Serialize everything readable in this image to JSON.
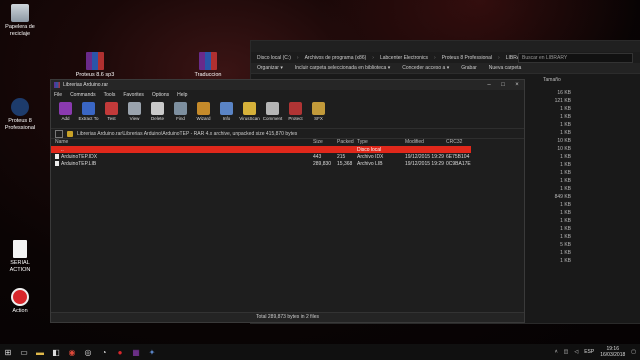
{
  "desktop": {
    "icons": [
      {
        "label": "Papelera de reciclaje"
      },
      {
        "label": "Proteus 8.6 sp3"
      },
      {
        "label": "Traduccion"
      },
      {
        "label": "Proteus 8 Professional"
      },
      {
        "label": "SERIAL ACTION"
      },
      {
        "label": "Action"
      }
    ]
  },
  "explorer": {
    "breadcrumbs": [
      "Disco local (C:)",
      "Archivos de programa (x86)",
      "Labcenter Electronics",
      "Proteus 8 Professional",
      "LIBRARY"
    ],
    "search_placeholder": "Buscar en LIBRARY",
    "toolbar": [
      "Organizar ▾",
      "Incluir carpeta seleccionada en biblioteca ▾",
      "Conceder acceso a ▾",
      "Grabar",
      "Nueva carpeta"
    ],
    "size_column": "Tamaño",
    "sizes": [
      "16 KB",
      "121 KB",
      "1 KB",
      "1 KB",
      "1 KB",
      "1 KB",
      "10 KB",
      "10 KB",
      "1 KB",
      "1 KB",
      "1 KB",
      "1 KB",
      "1 KB",
      "849 KB",
      "1 KB",
      "1 KB",
      "1 KB",
      "1 KB",
      "1 KB",
      "5 KB",
      "1 KB",
      "1 KB"
    ]
  },
  "rar": {
    "title": "Librerias Arduino.rar",
    "menu": [
      "File",
      "Commands",
      "Tools",
      "Favorites",
      "Options",
      "Help"
    ],
    "tools": [
      {
        "label": "Add",
        "color": "#8a3ab0"
      },
      {
        "label": "Extract To",
        "color": "#3a66c4"
      },
      {
        "label": "Test",
        "color": "#c23a3a"
      },
      {
        "label": "View",
        "color": "#9aa3ad"
      },
      {
        "label": "Delete",
        "color": "#c9c9c9"
      },
      {
        "label": "Find",
        "color": "#7d8f9f"
      },
      {
        "label": "Wizard",
        "color": "#c58a2a"
      },
      {
        "label": "Info",
        "color": "#5a84c6"
      },
      {
        "label": "VirusScan",
        "color": "#d6b13a"
      },
      {
        "label": "Comment",
        "color": "#b5b5b5"
      },
      {
        "label": "Protect",
        "color": "#b03434"
      },
      {
        "label": "SFX",
        "color": "#c29a3a"
      }
    ],
    "path": "Librerias Arduino.rar\\Librerias Arduino\\ArduinoTEP - RAR 4.x archive, unpacked size 415,870 bytes",
    "columns": {
      "name": "Name",
      "size": "Size",
      "packed": "Packed",
      "type": "Type",
      "modified": "Modified",
      "crc": "CRC32"
    },
    "rows": [
      {
        "name": "..",
        "size": "",
        "packed": "",
        "type": "Disco local",
        "modified": "",
        "crc": ""
      },
      {
        "name": "ArduinoTEP.IDX",
        "size": "443",
        "packed": "215",
        "type": "Archivo IDX",
        "modified": "19/12/2015 19:29",
        "crc": "6E75B104"
      },
      {
        "name": "ArduinoTEP.LIB",
        "size": "289,830",
        "packed": "15,368",
        "type": "Archivo LIB",
        "modified": "19/12/2015 19:29",
        "crc": "0C9BA17E"
      }
    ],
    "status": "Total 289,873 bytes in 2 files"
  },
  "taskbar": {
    "lang": "ESP",
    "time": "19:16",
    "date": "16/03/2018"
  }
}
